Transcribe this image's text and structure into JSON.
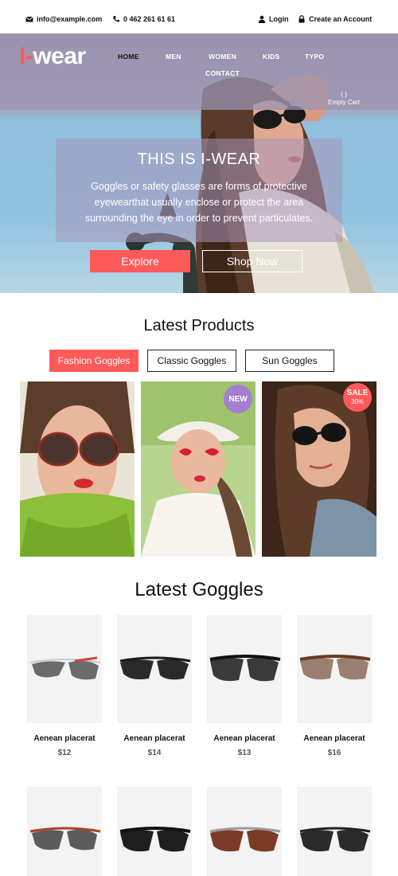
{
  "topbar": {
    "email": "info@example.com",
    "phone": "0 462 261 61 61",
    "login": "Login",
    "create_account": "Create an Account"
  },
  "brand": {
    "logo_mark": "I-",
    "logo_text": "wear",
    "accent": "#ff5a5a"
  },
  "nav": [
    {
      "label": "HOME",
      "active": true
    },
    {
      "label": "MEN"
    },
    {
      "label": "WOMEN"
    },
    {
      "label": "KIDS"
    },
    {
      "label": "TYPO"
    },
    {
      "label": "CONTACT"
    }
  ],
  "cart": {
    "label": "Empty Cart",
    "icon": "cart-icon"
  },
  "hero": {
    "title": "THIS IS I-WEAR",
    "text": "Goggles or safety glasses are forms of protective eyewearthat usually enclose or protect the area surrounding the eye in order to prevent particulates.",
    "explore_label": "Explore",
    "shop_label": "Shop Now"
  },
  "latest_products": {
    "title": "Latest Products",
    "tabs": [
      "Fashion Goggles",
      "Classic Goggles",
      "Sun Goggles"
    ],
    "active_tab": "Fashion Goggles",
    "badges": {
      "new": "NEW",
      "sale": "SALE",
      "sale_percent": "30%"
    }
  },
  "latest_goggles": {
    "title": "Latest Goggles",
    "items": [
      {
        "name": "Aenean placerat",
        "price": "$12"
      },
      {
        "name": "Aenean placerat",
        "price": "$14"
      },
      {
        "name": "Aenean placerat",
        "price": "$13"
      },
      {
        "name": "Aenean placerat",
        "price": "$16"
      }
    ]
  },
  "colors": {
    "accent": "#ff5a5a",
    "badge_new": "#a27fd0",
    "nav_band": "#9b94b2",
    "card_bg": "#f3f3f3"
  }
}
